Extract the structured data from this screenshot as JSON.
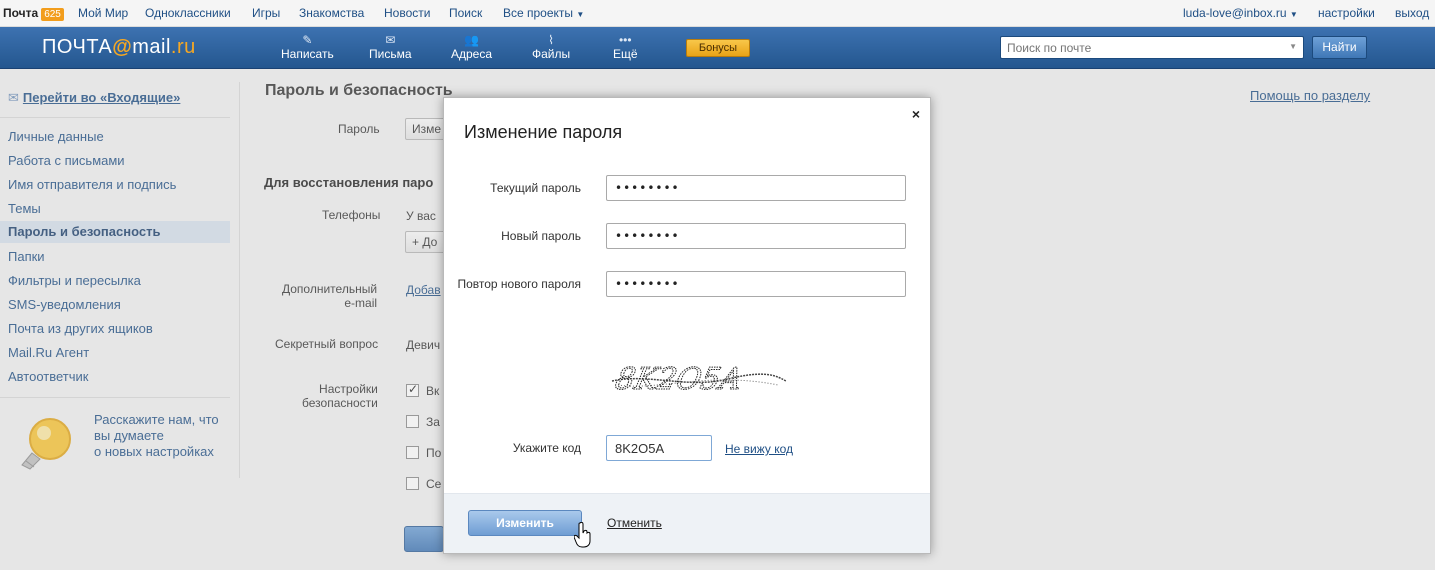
{
  "portal": {
    "brand": "Почта",
    "badge": "625",
    "links": [
      "Мой Мир",
      "Одноклассники",
      "Игры",
      "Знакомства",
      "Новости",
      "Поиск",
      "Все проекты"
    ],
    "user": "luda-love@inbox.ru",
    "settings": "настройки",
    "logout": "выход"
  },
  "header": {
    "logo_left": "ПОЧТА",
    "logo_at": "@",
    "logo_mail": "mail",
    "logo_ru": ".ru",
    "nav": [
      {
        "label": "Написать",
        "icon": "pencil-icon"
      },
      {
        "label": "Письма",
        "icon": "envelope-icon"
      },
      {
        "label": "Адреса",
        "icon": "contacts-icon"
      },
      {
        "label": "Файлы",
        "icon": "paperclip-icon"
      },
      {
        "label": "Ещё",
        "icon": "more-dots-icon"
      }
    ],
    "bonus": "Бонусы",
    "search_placeholder": "Поиск по почте",
    "find": "Найти"
  },
  "sidebar": {
    "inbox_link": "Перейти во «Входящие»",
    "items": [
      "Личные данные",
      "Работа с письмами",
      "Имя отправителя и подпись",
      "Темы",
      "Пароль и безопасность",
      "Папки",
      "Фильтры и пересылка",
      "SMS-уведомления",
      "Почта из других ящиков",
      "Mail.Ru Агент",
      "Автоответчик"
    ],
    "active_index": 4,
    "feedback": [
      "Расскажите нам, что",
      "вы думаете",
      "о новых настройках"
    ]
  },
  "main": {
    "title": "Пароль и безопасность",
    "help": "Помощь по разделу",
    "password_label": "Пароль",
    "password_button": "Изме",
    "recovery_heading": "Для восстановления паро",
    "phones_label": "Телефоны",
    "phones_value": "У вас",
    "add_phone": "+ До",
    "extra_email_label_1": "Дополнительный",
    "extra_email_label_2": "e-mail",
    "extra_email_link": "Добав",
    "secret_label": "Секретный вопрос",
    "secret_value": "Девич",
    "security_label_1": "Настройки",
    "security_label_2": "безопасности",
    "security_options": [
      "Вк",
      "За",
      "По",
      "Се"
    ]
  },
  "modal": {
    "title": "Изменение пароля",
    "close": "×",
    "current_label": "Текущий пароль",
    "current_value": "••••••••",
    "new_label": "Новый пароль",
    "new_value": "••••••••",
    "repeat_label": "Повтор нового пароля",
    "repeat_value": "••••••••",
    "captcha_text": "8K2O5A",
    "code_label": "Укажите код",
    "code_value": "8K2O5A",
    "no_see": "Не вижу код",
    "submit": "Изменить",
    "cancel": "Отменить"
  }
}
